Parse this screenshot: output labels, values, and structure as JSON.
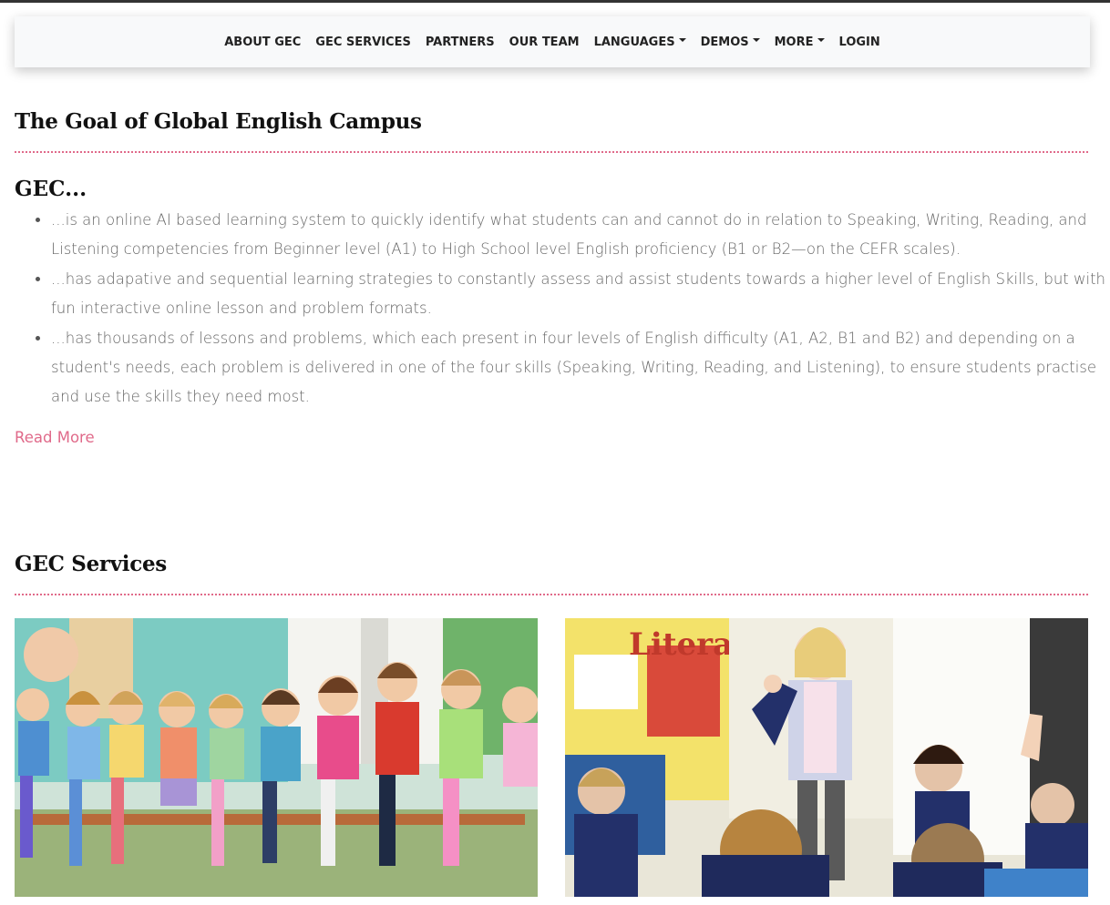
{
  "nav": {
    "items": [
      {
        "label": "ABOUT GEC",
        "dropdown": false
      },
      {
        "label": "GEC SERVICES",
        "dropdown": false
      },
      {
        "label": "PARTNERS",
        "dropdown": false
      },
      {
        "label": "OUR TEAM",
        "dropdown": false
      },
      {
        "label": "LANGUAGES",
        "dropdown": true
      },
      {
        "label": "DEMOS",
        "dropdown": true
      },
      {
        "label": "MORE",
        "dropdown": true
      },
      {
        "label": "LOGIN",
        "dropdown": false
      }
    ]
  },
  "goal": {
    "title": "The Goal of Global English Campus",
    "subtitle": "GEC...",
    "points": [
      "...is an online AI based learning system to quickly identify what students can and cannot do in relation to Speaking, Writing, Reading, and Listening competencies from Beginner level (A1) to High School level English proficiency (B1 or B2—on the CEFR scales).",
      "...has adapative and sequential learning strategies to constantly assess and assist students towards a higher level of English Skills, but with fun interactive online lesson and problem formats.",
      "...has thousands of lessons and problems, which each present in four levels of English difficulty (A1, A2, B1 and B2) and depending on a student's needs, each problem is delivered in one of the four skills (Speaking, Writing, Reading, and Listening), to ensure students practise and use the skills they need most."
    ],
    "read_more": "Read More"
  },
  "services": {
    "title": "GEC Services",
    "images": [
      {
        "name": "kids-sitting-photo"
      },
      {
        "name": "classroom-teacher-photo"
      }
    ]
  },
  "colors": {
    "accent": "#e06a8a",
    "text": "#666666",
    "heading": "#111111"
  }
}
